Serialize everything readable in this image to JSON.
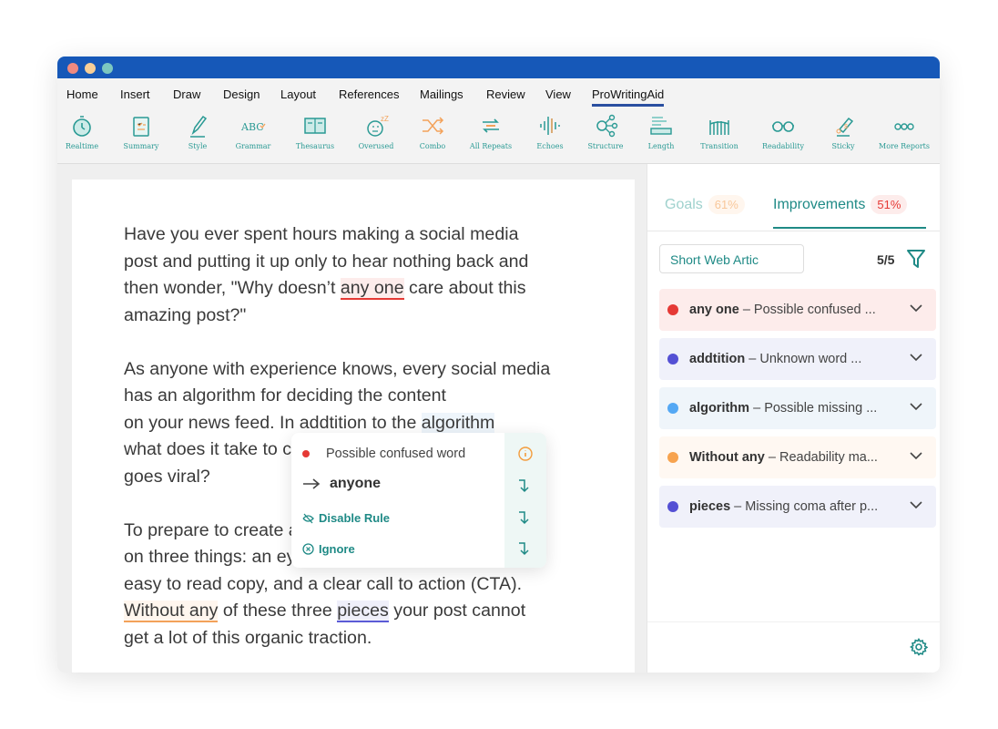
{
  "window": {
    "traffic_lights": [
      "#ef8a80",
      "#f8cf97",
      "#7cc7c0"
    ],
    "titlebar_color": "#1658b8"
  },
  "menu": [
    "Home",
    "Insert",
    "Draw",
    "Design",
    "Layout",
    "References",
    "Mailings",
    "Review",
    "View",
    "ProWritingAid"
  ],
  "toolbar": [
    "Realtime",
    "Summary",
    "Style",
    "Grammar",
    "Thesaurus",
    "Overused",
    "Combo",
    "All Repeats",
    "Echoes",
    "Structure",
    "Length",
    "Transition",
    "Readability",
    "Sticky",
    "More Reports"
  ],
  "document": {
    "paragraphs": [
      [
        [
          {
            "t": "Have you ever spent hours making a social media"
          }
        ],
        [
          {
            "t": "post and putting it up only to hear nothing back and"
          }
        ],
        [
          {
            "t": "then wonder, \"Why doesn’t "
          },
          {
            "t": "any one",
            "m": "red"
          },
          {
            "t": " care about this"
          }
        ],
        [
          {
            "t": "amazing post?\""
          }
        ]
      ],
      [
        [
          {
            "t": "As anyone with experience knows, every social media"
          }
        ],
        [
          {
            "t": "has an algorithm for deciding the content"
          }
        ],
        [
          {
            "t": "on your news feed. In addtition to the "
          },
          {
            "t": "algorithm",
            "m": "blue"
          }
        ],
        [
          {
            "t": "what does it take to craft a social media post that"
          }
        ],
        [
          {
            "t": "goes viral?"
          }
        ]
      ],
      [
        [
          {
            "t": "To prepare to create a great post, you need to focus"
          }
        ],
        [
          {
            "t": "on three things: an eye popping image, engaging and"
          }
        ],
        [
          {
            "t": "easy to read copy, and a clear call to action (CTA)."
          }
        ],
        [
          {
            "t": "Without any",
            "m": "orange"
          },
          {
            "t": " of these three "
          },
          {
            "t": "pieces",
            "m": "purple"
          },
          {
            "t": " your post cannot"
          }
        ],
        [
          {
            "t": "get a lot of this organic traction."
          }
        ]
      ]
    ]
  },
  "popup": {
    "title": "Possible confused word",
    "suggestion": "anyone",
    "disable": "Disable Rule",
    "ignore": "Ignore"
  },
  "sidebar": {
    "tabs": [
      {
        "label": "Goals",
        "value": "61%"
      },
      {
        "label": "Improvements",
        "value": "51%",
        "active": true
      }
    ],
    "doc_type": "Short Web Artic",
    "count": "5/5",
    "issues": [
      {
        "word": "any one",
        "desc": "Possible confused ...",
        "color": "#e53935",
        "bg": "#fdeceb"
      },
      {
        "word": "addtition",
        "desc": "Unknown word ...",
        "color": "#5450d4",
        "bg": "#f0f1fa"
      },
      {
        "word": "algorithm",
        "desc": "Possible missing ...",
        "color": "#54a8f4",
        "bg": "#eff5fa"
      },
      {
        "word": "Without any",
        "desc": "Readability ma...",
        "color": "#f7a34f",
        "bg": "#fff8f2"
      },
      {
        "word": "pieces",
        "desc": "Missing coma after p...",
        "color": "#5450d4",
        "bg": "#f0f1fa"
      }
    ]
  },
  "colors": {
    "accent": "#1f8a86"
  }
}
